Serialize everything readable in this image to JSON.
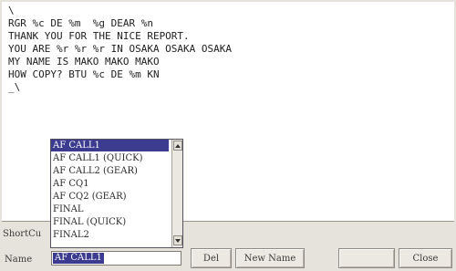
{
  "editor": {
    "cursor_top": "\\",
    "lines": [
      "RGR %c DE %m  %g DEAR %n",
      "THANK YOU FOR THE NICE REPORT.",
      "YOU ARE %r %r %r IN OSAKA OSAKA OSAKA",
      "MY NAME IS MAKO MAKO MAKO",
      "HOW COPY? BTU %c DE %m KN"
    ],
    "cursor_bottom": "_\\"
  },
  "shortcut_label": "ShortCu",
  "name_label": "Name",
  "name_combo": {
    "value": "AF CALL1",
    "options": [
      "AF CALL1",
      "AF CALL1 (QUICK)",
      "AF CALL2 (GEAR)",
      "AF CQ1",
      "AF CQ2 (GEAR)",
      "FINAL",
      "FINAL (QUICK)",
      "FINAL2"
    ]
  },
  "buttons": {
    "delete": "Del",
    "new_name": "New Name",
    "close": "Close"
  },
  "colors": {
    "selection": "#3b3b8f",
    "panel": "#e6e3dc"
  }
}
